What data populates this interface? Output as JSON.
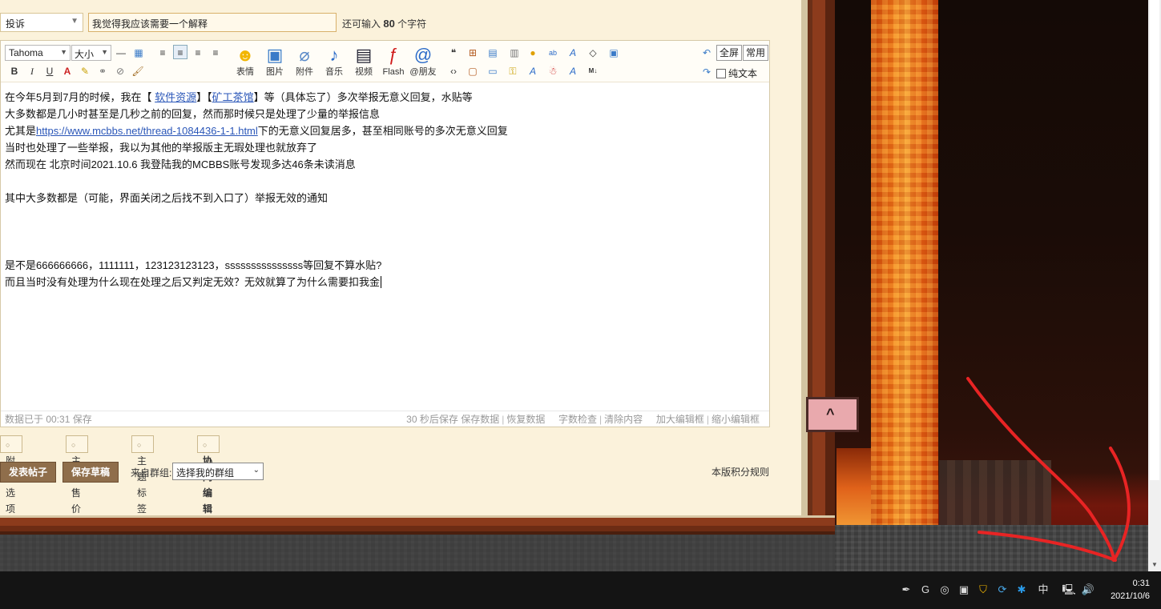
{
  "post": {
    "type_select": "投诉",
    "subject": "我觉得我应该需要一个解释",
    "char_count_prefix": "还可输入",
    "char_count_value": "80",
    "char_count_suffix": "个字符"
  },
  "toolbar": {
    "font": "Tahoma",
    "size": "大小",
    "emoji": "表情",
    "image": "图片",
    "attachment": "附件",
    "music": "音乐",
    "video": "视频",
    "flash": "Flash",
    "mention": "@朋友",
    "fullscreen": "全屏",
    "common": "常用",
    "plain_text": "纯文本"
  },
  "content": {
    "line1_a": "在今年5月到7月的时候，我在【",
    "line1_link1": "软件资源",
    "line1_b": "】【",
    "line1_link2": "矿工茶馆",
    "line1_c": "】等（具体忘了）多次举报无意义回复，水贴等",
    "line2": "大多数都是几小时甚至是几秒之前的回复，然而那时候只是处理了少量的举报信息",
    "line3_a": "尤其是",
    "line3_link": "https://www.mcbbs.net/thread-1084436-1-1.html",
    "line3_b": "下的无意义回复居多，甚至相同账号的多次无意义回复",
    "line4": "当时也处理了一些举报，我以为其他的举报版主无瑕处理也就放弃了",
    "line5": "然而现在  北京时间2021.10.6 我登陆我的MCBBS账号发现多达46条未读消息",
    "line7": "其中大多数都是（可能，界面关闭之后找不到入口了）举报无效的通知",
    "line11": "是不是666666666，1111111，123123123123，sssssssssssssss等回复不算水贴?",
    "line12": "而且当时没有处理为什么现在处理之后又判定无效？无效就算了为什么需要扣我金"
  },
  "status": {
    "saved": "数据已于 00:31 保存",
    "autosave": "30 秒后保存",
    "save_data": "保存数据",
    "restore_data": "恢复数据",
    "word_check": "字数检查",
    "clear": "清除内容",
    "enlarge": "加大编辑框",
    "shrink": "缩小编辑框"
  },
  "options": {
    "extra": "附加选项",
    "price": "主题售价",
    "tags": "主题标签",
    "collab": "协同编辑"
  },
  "actions": {
    "post": "发表帖子",
    "draft": "保存草稿",
    "group_label": "来自群组:",
    "group_select": "选择我的群组",
    "rules": "本版积分规则"
  },
  "taskbar": {
    "ime": "中",
    "time": "0:31",
    "date": "2021/10/6"
  }
}
